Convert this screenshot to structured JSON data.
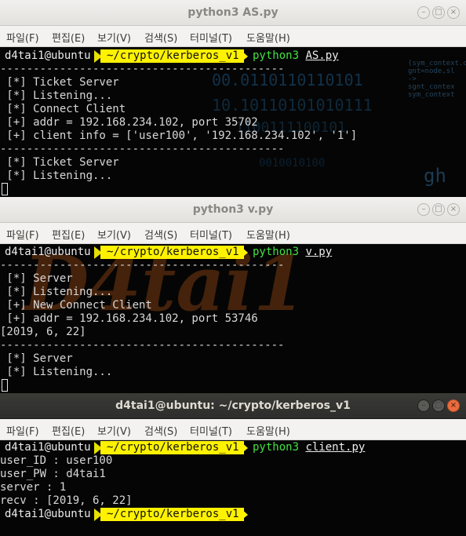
{
  "menu": [
    "파일(F)",
    "편집(E)",
    "보기(V)",
    "검색(S)",
    "터미널(T)",
    "도움말(H)"
  ],
  "window_controls": {
    "minimize": "–",
    "maximize": "□",
    "close": "×"
  },
  "icons": [
    "minimize-icon",
    "maximize-icon",
    "close-icon"
  ],
  "colors": {
    "prompt_path_bg": "#fff200",
    "prompt_cmd": "#42e142",
    "terminal_bg": "#050505",
    "active_titlebar": "#2d2d2b",
    "close_button": "#e96d3e"
  },
  "background_watermark": "D4tai1",
  "window1": {
    "title": "python3 AS.py",
    "prompt": {
      "user": "d4tai1@ubuntu",
      "path": "~/crypto/kerberos_v1",
      "cmd": "python3",
      "arg": "AS.py"
    },
    "lines": [
      "-------------------------------------------",
      " [*] Ticket Server",
      " [*] Listening...",
      " [*] Connect Client",
      " [+] addr = 192.168.234.102, port 35702",
      " [+] client info = ['user100', '192.168.234.102', '1']",
      "-------------------------------------------",
      " [*] Ticket Server",
      " [*] Listening..."
    ]
  },
  "window2": {
    "title": "python3 v.py",
    "prompt": {
      "user": "d4tai1@ubuntu",
      "path": "~/crypto/kerberos_v1",
      "cmd": "python3",
      "arg": "v.py"
    },
    "lines": [
      "-------------------------------------------",
      " [*] Server",
      " [*] Listening...",
      " [+] New Connect Client",
      " [+] addr = 192.168.234.102, port 53746",
      "[2019, 6, 22]",
      "-------------------------------------------",
      " [*] Server",
      " [*] Listening..."
    ]
  },
  "window3": {
    "title": "d4tai1@ubuntu: ~/crypto/kerberos_v1",
    "prompt": {
      "user": "d4tai1@ubuntu",
      "path": "~/crypto/kerberos_v1",
      "cmd": "python3",
      "arg": "client.py"
    },
    "lines": [
      "user_ID : user100",
      "user_PW : d4tai1",
      "server : 1",
      "recv : [2019, 6, 22]"
    ],
    "prompt2": {
      "user": "d4tai1@ubuntu",
      "path": "~/crypto/kerberos_v1"
    }
  }
}
